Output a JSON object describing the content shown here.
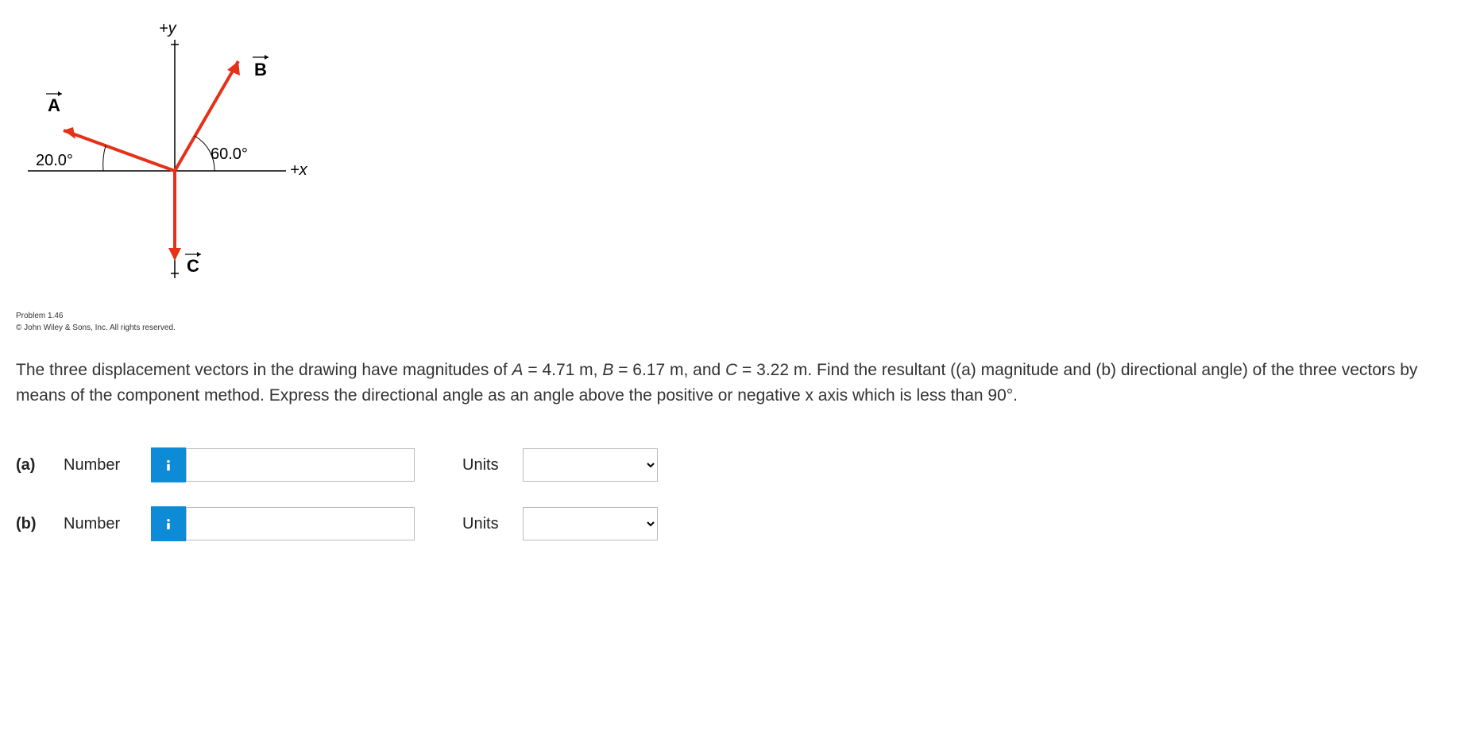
{
  "diagram": {
    "y_axis_label": "+y",
    "x_axis_label": "+x",
    "vector_A_label": "A",
    "vector_B_label": "B",
    "vector_C_label": "C",
    "angle_A": "20.0°",
    "angle_B": "60.0°"
  },
  "copyright": {
    "line1": "Problem 1.46",
    "line2": "© John Wiley & Sons, Inc. All rights reserved."
  },
  "problem": {
    "text_1": "The three displacement vectors in the drawing have magnitudes of ",
    "A_eq": "A",
    "A_val": " = 4.71 m, ",
    "B_eq": "B",
    "B_val": " = 6.17 m, and ",
    "C_eq": "C",
    "C_val": " = 3.22 m. Find the resultant ((a) magnitude and (b) directional angle) of the three vectors by means of the component method. Express the directional angle as an angle above the positive or negative x axis which is less than 90°."
  },
  "answers": {
    "a": {
      "part": "(a)",
      "number_label": "Number",
      "units_label": "Units"
    },
    "b": {
      "part": "(b)",
      "number_label": "Number",
      "units_label": "Units"
    }
  }
}
